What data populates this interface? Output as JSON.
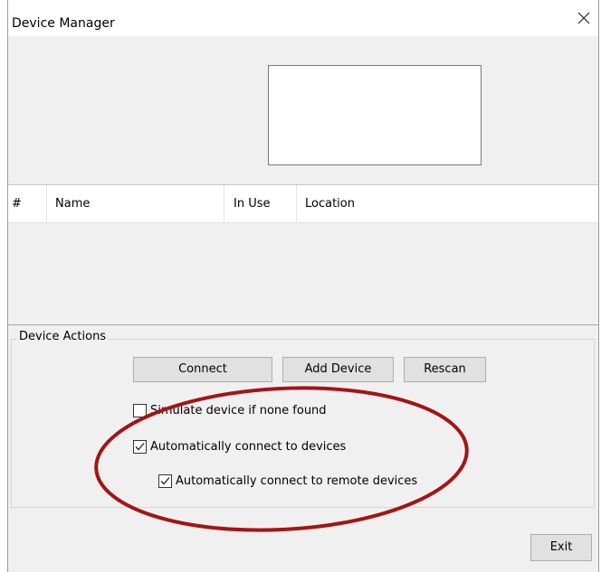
{
  "window": {
    "title": "Device Manager"
  },
  "table": {
    "columns": [
      "#",
      "Name",
      "In Use",
      "Location"
    ],
    "rows": []
  },
  "group": {
    "label": "Device Actions"
  },
  "actions": {
    "connect_label": "Connect",
    "add_device_label": "Add Device",
    "rescan_label": "Rescan"
  },
  "options": {
    "simulate": {
      "label": "Simulate device if none found",
      "checked": false
    },
    "auto_connect": {
      "label": "Automatically connect to devices",
      "checked": true
    },
    "auto_connect_remote": {
      "label": "Automatically connect to remote devices",
      "checked": true
    }
  },
  "footer": {
    "exit_label": "Exit"
  },
  "colors": {
    "annotation": "#a31515",
    "window_bg": "#f0f0f0",
    "button_bg": "#e1e1e1"
  }
}
